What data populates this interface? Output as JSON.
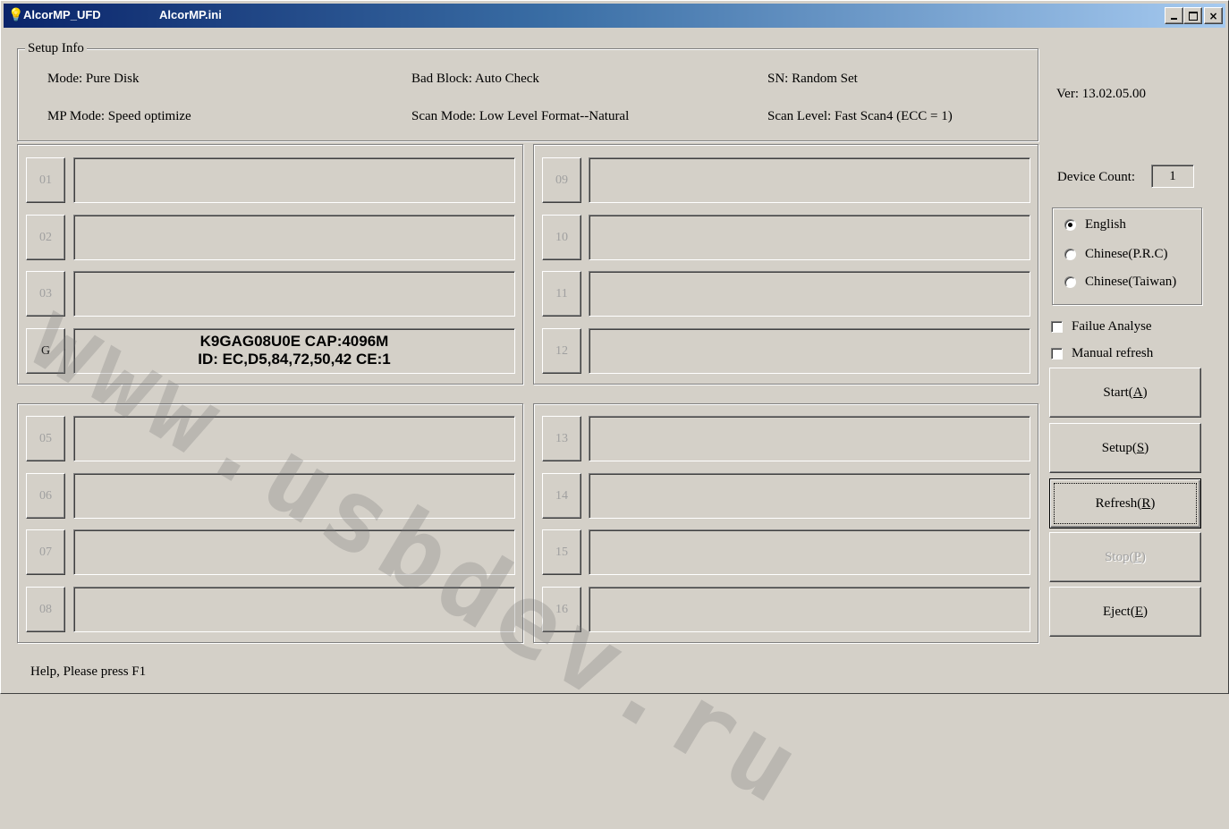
{
  "window": {
    "app_name": "AlcorMP_UFD",
    "ini_name": "AlcorMP.ini",
    "app_icon": "lightbulb-icon",
    "controls": {
      "minimize": "_",
      "maximize": "□",
      "close": "×"
    }
  },
  "setup_info": {
    "label": "Setup Info",
    "mode": "Mode: Pure Disk",
    "bad_block": "Bad Block: Auto Check",
    "sn": "SN: Random Set",
    "mp_mode": "MP Mode: Speed optimize",
    "scan_mode": "Scan Mode: Low Level Format--Natural",
    "scan_level": "Scan Level: Fast Scan4 (ECC = 1)"
  },
  "version": "Ver: 13.02.05.00",
  "device_count": {
    "label": "Device Count:",
    "value": "1"
  },
  "language": {
    "options": [
      "English",
      "Chinese(P.R.C)",
      "Chinese(Taiwan)"
    ],
    "selected": "English"
  },
  "options": {
    "failure_analyse": "Failue Analyse",
    "manual_refresh": "Manual refresh"
  },
  "buttons": {
    "start": "Start(A)",
    "setup": "Setup(S)",
    "refresh": "Refresh(R)",
    "stop": "Stop(P)",
    "eject": "Eject(E)"
  },
  "slots": [
    {
      "id": "01",
      "line1": "",
      "line2": ""
    },
    {
      "id": "02",
      "line1": "",
      "line2": ""
    },
    {
      "id": "03",
      "line1": "",
      "line2": ""
    },
    {
      "id": "G",
      "line1": "K9GAG08U0E CAP:4096M",
      "line2": "ID: EC,D5,84,72,50,42  CE:1"
    },
    {
      "id": "05",
      "line1": "",
      "line2": ""
    },
    {
      "id": "06",
      "line1": "",
      "line2": ""
    },
    {
      "id": "07",
      "line1": "",
      "line2": ""
    },
    {
      "id": "08",
      "line1": "",
      "line2": ""
    },
    {
      "id": "09",
      "line1": "",
      "line2": ""
    },
    {
      "id": "10",
      "line1": "",
      "line2": ""
    },
    {
      "id": "11",
      "line1": "",
      "line2": ""
    },
    {
      "id": "12",
      "line1": "",
      "line2": ""
    },
    {
      "id": "13",
      "line1": "",
      "line2": ""
    },
    {
      "id": "14",
      "line1": "",
      "line2": ""
    },
    {
      "id": "15",
      "line1": "",
      "line2": ""
    },
    {
      "id": "16",
      "line1": "",
      "line2": ""
    }
  ],
  "status_bar": "Help, Please press F1",
  "watermark": "www.usbdev.ru"
}
